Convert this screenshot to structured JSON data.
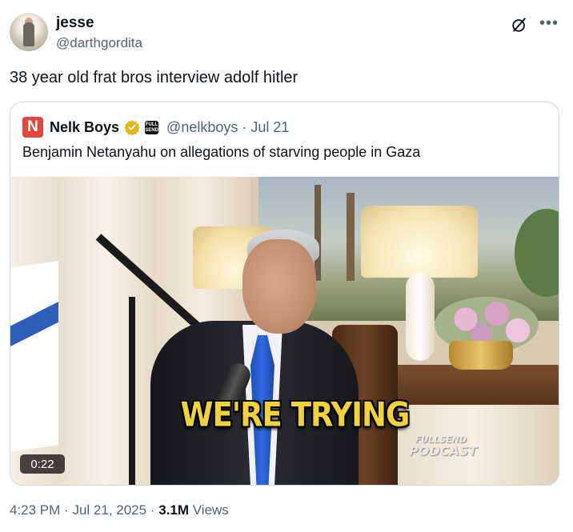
{
  "author": {
    "name": "jesse",
    "handle": "@darthgordita"
  },
  "tweet": {
    "text": "38 year old frat bros interview adolf hitler"
  },
  "quoted": {
    "name": "Nelk Boys",
    "logo_letter": "N",
    "affiliate_label": "FULL SEND",
    "handle": "@nelkboys",
    "separator": "·",
    "date": "Jul 21",
    "text": "Benjamin Netanyahu on allegations of starving people in Gaza",
    "video": {
      "caption": "WE'RE TRYING",
      "watermark_top": "FULLSEND",
      "watermark_bottom": "PODCAST",
      "duration": "0:22"
    }
  },
  "meta": {
    "time": "4:23 PM",
    "separator": "·",
    "date": "Jul 21, 2025",
    "views_count": "3.1M",
    "views_label": "Views"
  },
  "icons": {
    "grok": "grok-icon",
    "more": "more-icon",
    "verified": "verified-gold-badge-icon",
    "verified_color": "#e2b719"
  }
}
